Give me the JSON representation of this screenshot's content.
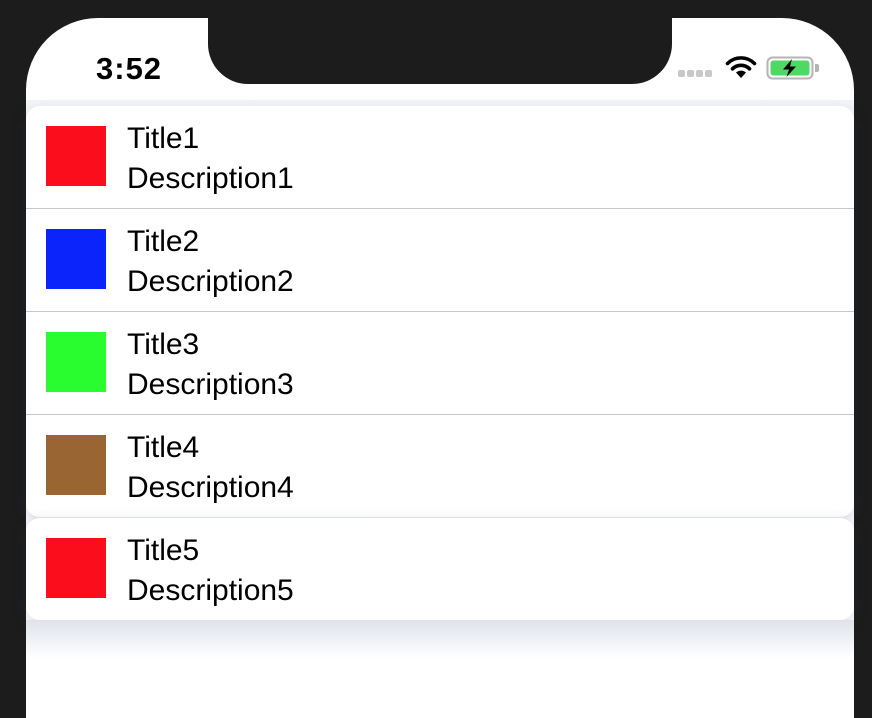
{
  "status_bar": {
    "time": "3:52",
    "signal_icon": "cellular-dots-icon",
    "wifi_icon": "wifi-icon",
    "battery_icon": "battery-charging-icon",
    "battery_color": "#4cd964"
  },
  "list": {
    "items": [
      {
        "title": "Title1",
        "description": "Description1",
        "color": "#fc0d1b"
      },
      {
        "title": "Title2",
        "description": "Description2",
        "color": "#0b24fb"
      },
      {
        "title": "Title3",
        "description": "Description3",
        "color": "#29fd2f"
      },
      {
        "title": "Title4",
        "description": "Description4",
        "color": "#996633"
      }
    ],
    "separate_items": [
      {
        "title": "Title5",
        "description": "Description5",
        "color": "#fc0d1b"
      }
    ]
  }
}
